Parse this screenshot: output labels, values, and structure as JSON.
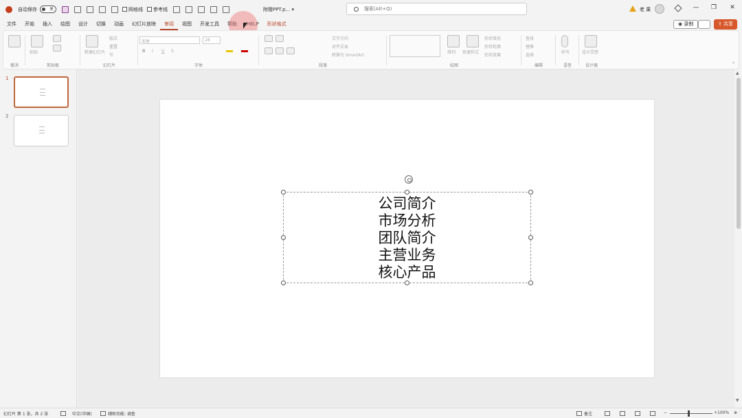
{
  "titlebar": {
    "autosave_label": "自动保存",
    "autosave_state": "关",
    "gridlines_label": "网格线",
    "guides_label": "参考线",
    "doc_title": "附赠PPT.p... ▾",
    "search_placeholder": "搜索(Alt+Q)",
    "user_name": "老 果",
    "minimize": "—",
    "restore": "❐",
    "close": "✕"
  },
  "menu": {
    "tabs": [
      "文件",
      "开始",
      "插入",
      "绘图",
      "设计",
      "切换",
      "动画",
      "幻灯片放映",
      "审阅",
      "视图",
      "开发工具",
      "帮助",
      "iHELP",
      "形状格式"
    ],
    "active_tab": "审阅",
    "record_label": "◉ 录制",
    "share_label": "⇪ 共享"
  },
  "ribbon": {
    "groups": [
      "撤消",
      "剪贴板",
      "幻灯片",
      "字体",
      "段落",
      "绘图",
      "编辑",
      "语音",
      "设计器"
    ],
    "clipboard_paste": "粘贴",
    "slide_new": "新建幻灯片",
    "slide_layout": "版式",
    "slide_reset": "重置",
    "slide_section": "节",
    "font_name": "宋体",
    "font_size": "28",
    "text_direction": "文字方向",
    "align_text": "对齐文本",
    "convert_smartart": "转换为 SmartArt",
    "arrange": "排列",
    "quick_styles": "快速样式",
    "shape_fill": "形状填充",
    "shape_outline": "形状轮廓",
    "shape_effects": "形状效果",
    "find": "查找",
    "replace": "替换",
    "select": "选择",
    "dictate": "听写",
    "designer": "设计灵感"
  },
  "thumbnails": [
    {
      "number": "1"
    },
    {
      "number": "2"
    }
  ],
  "slide": {
    "lines": [
      "公司简介",
      "市场分析",
      "团队简介",
      "主营业务",
      "核心产品"
    ]
  },
  "statusbar": {
    "slide_count": "幻灯片 第 1 张，共 2 张",
    "language": "中文(中国)",
    "accessibility": "辅助功能: 调查",
    "notes": "备注",
    "zoom": "100%"
  }
}
